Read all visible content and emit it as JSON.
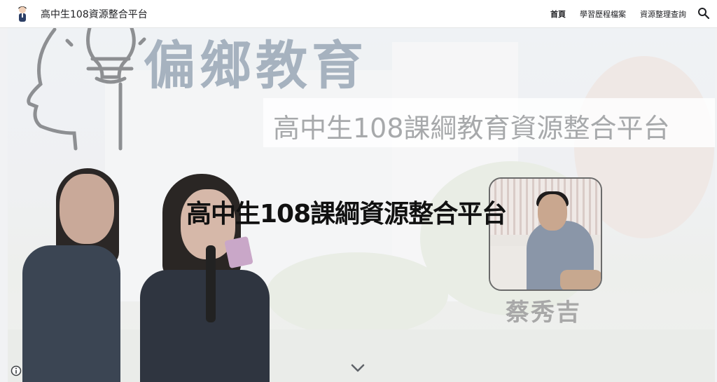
{
  "header": {
    "site_title": "高中生108資源整合平台",
    "nav": [
      {
        "label": "首頁",
        "active": true
      },
      {
        "label": "學習歷程檔案",
        "active": false
      },
      {
        "label": "資源整理查詢",
        "active": false
      }
    ],
    "search_icon": "search-icon",
    "logo_icon": "student-avatar-icon"
  },
  "hero": {
    "banner_headline": "偏鄉教育",
    "banner_subtitle": "高中生108課綱教育資源整合平台",
    "title": "高中生108課綱資源整合平台",
    "profile_name": "蔡秀吉",
    "scroll_icon": "chevron-down-icon",
    "info_icon": "info-icon"
  },
  "colors": {
    "headline": "#a6b2bf",
    "subtitle": "#a7a9ab",
    "title": "#111111",
    "name": "#a8a8a8"
  }
}
